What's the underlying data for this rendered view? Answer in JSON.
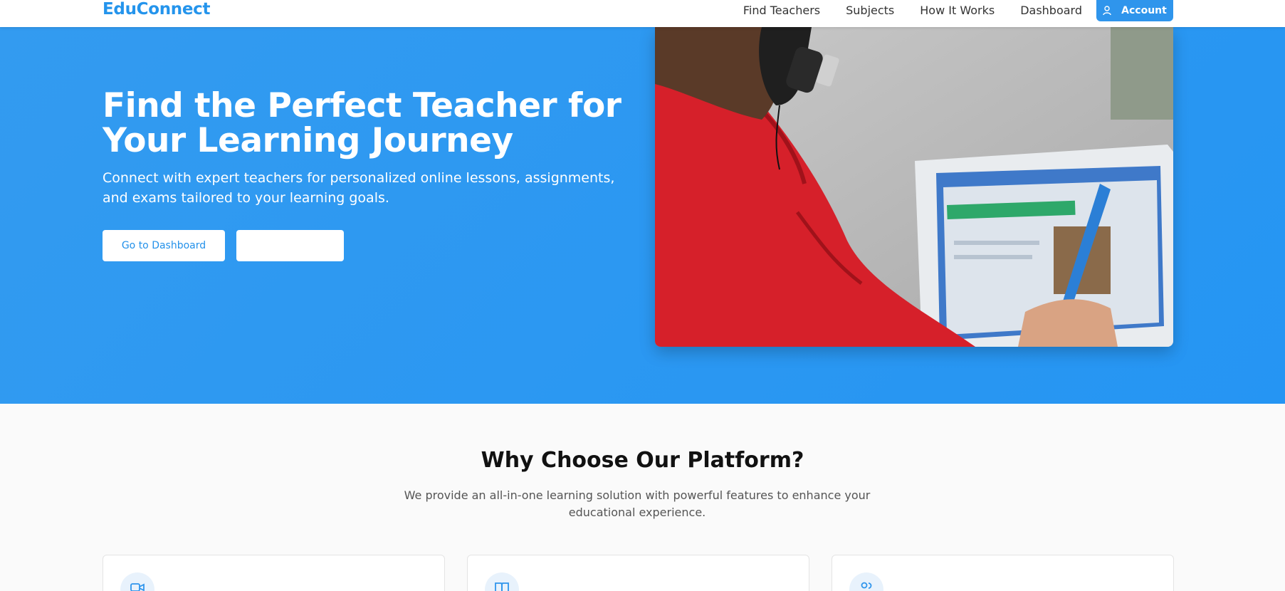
{
  "header": {
    "logo": "EduConnect",
    "nav": [
      "Find Teachers",
      "Subjects",
      "How It Works",
      "Dashboard"
    ],
    "account_label": "Account"
  },
  "hero": {
    "title": "Find the Perfect Teacher for Your Learning Journey",
    "subtitle": "Connect with expert teachers for personalized online lessons, assignments, and exams tailored to your learning goals.",
    "primary_button": "Go to Dashboard",
    "secondary_button": ""
  },
  "features": {
    "title": "Why Choose Our Platform?",
    "subtitle": "We provide an all-in-one learning solution with powerful features to enhance your educational experience.",
    "cards": [
      {
        "icon": "video-icon"
      },
      {
        "icon": "book-icon"
      },
      {
        "icon": "users-icon"
      }
    ]
  },
  "colors": {
    "accent": "#2f95ec",
    "hero_bg": "#2595f3"
  }
}
